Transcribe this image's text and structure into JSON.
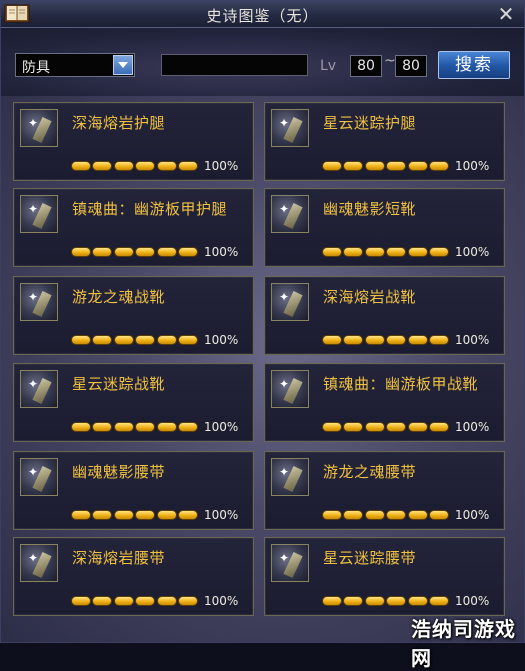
{
  "window": {
    "title": "史诗图鉴（无）",
    "close_symbol": "✕"
  },
  "filters": {
    "category_select": {
      "value": "防具"
    },
    "name_input": {
      "value": "",
      "placeholder": ""
    },
    "level_label": "Lv",
    "level_min": "80",
    "level_separator": "~",
    "level_max": "80",
    "search_button": "搜索"
  },
  "items": [
    {
      "name": "深海熔岩护腿",
      "progress_percent": 100,
      "progress_text": "100%",
      "icon": "leg-armor-icon"
    },
    {
      "name": "星云迷踪护腿",
      "progress_percent": 100,
      "progress_text": "100%",
      "icon": "leg-armor-icon"
    },
    {
      "name": "镇魂曲：幽游板甲护腿",
      "progress_percent": 100,
      "progress_text": "100%",
      "icon": "leg-armor-icon"
    },
    {
      "name": "幽魂魅影短靴",
      "progress_percent": 100,
      "progress_text": "100%",
      "icon": "boots-icon"
    },
    {
      "name": "游龙之魂战靴",
      "progress_percent": 100,
      "progress_text": "100%",
      "icon": "boots-icon"
    },
    {
      "name": "深海熔岩战靴",
      "progress_percent": 100,
      "progress_text": "100%",
      "icon": "boots-icon"
    },
    {
      "name": "星云迷踪战靴",
      "progress_percent": 100,
      "progress_text": "100%",
      "icon": "boots-icon"
    },
    {
      "name": "镇魂曲：幽游板甲战靴",
      "progress_percent": 100,
      "progress_text": "100%",
      "icon": "boots-icon"
    },
    {
      "name": "幽魂魅影腰带",
      "progress_percent": 100,
      "progress_text": "100%",
      "icon": "belt-icon"
    },
    {
      "name": "游龙之魂腰带",
      "progress_percent": 100,
      "progress_text": "100%",
      "icon": "belt-icon"
    },
    {
      "name": "深海熔岩腰带",
      "progress_percent": 100,
      "progress_text": "100%",
      "icon": "belt-icon"
    },
    {
      "name": "星云迷踪腰带",
      "progress_percent": 100,
      "progress_text": "100%",
      "icon": "belt-icon"
    }
  ],
  "watermark": "浩纳司游戏网",
  "colors": {
    "item_name": "#f0c040",
    "progress_fill": "#f2b51d",
    "search_button": "#2459a8"
  }
}
